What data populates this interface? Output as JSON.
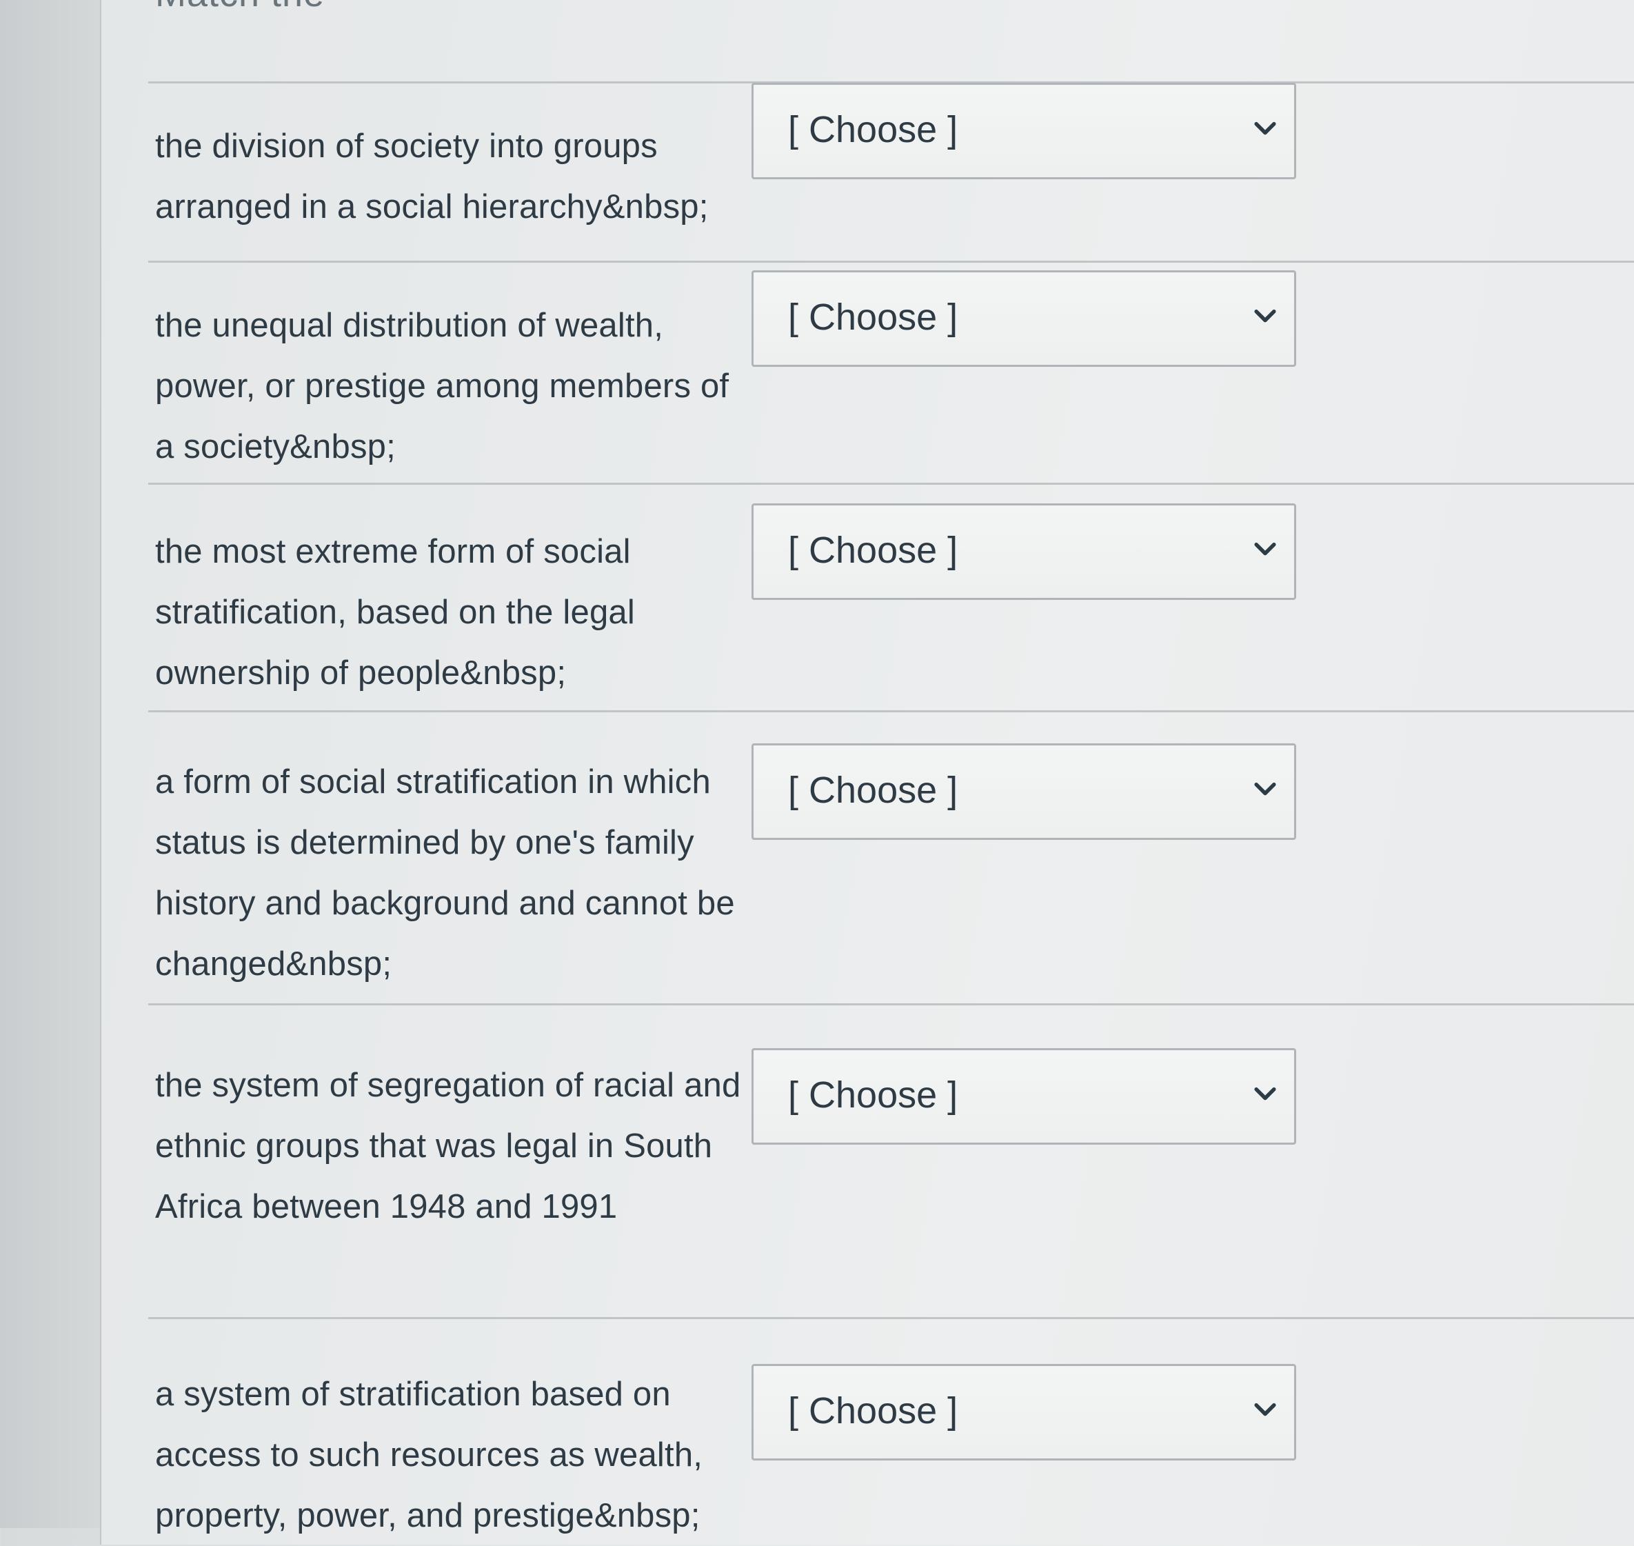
{
  "partial_header": "Match the",
  "placeholder": "[ Choose ]",
  "rows": [
    {
      "prompt": "the division of society into groups arranged in a social hierarchy&nbsp;",
      "selected": "[ Choose ]"
    },
    {
      "prompt": "the unequal distribution of wealth, power, or prestige among members of a society&nbsp;",
      "selected": "[ Choose ]"
    },
    {
      "prompt": "the most extreme form of social stratification, based on the legal ownership of people&nbsp;",
      "selected": "[ Choose ]"
    },
    {
      "prompt": "a form of social stratification in which status is determined by one's family history and background and cannot be changed&nbsp;",
      "selected": "[ Choose ]"
    },
    {
      "prompt": "the system of segregation of racial and ethnic groups that was legal in South Africa between 1948 and 1991",
      "selected": "[ Choose ]"
    },
    {
      "prompt": "a system of stratification based on access to such resources as wealth, property, power, and prestige&nbsp;",
      "selected": "[ Choose ]"
    }
  ]
}
